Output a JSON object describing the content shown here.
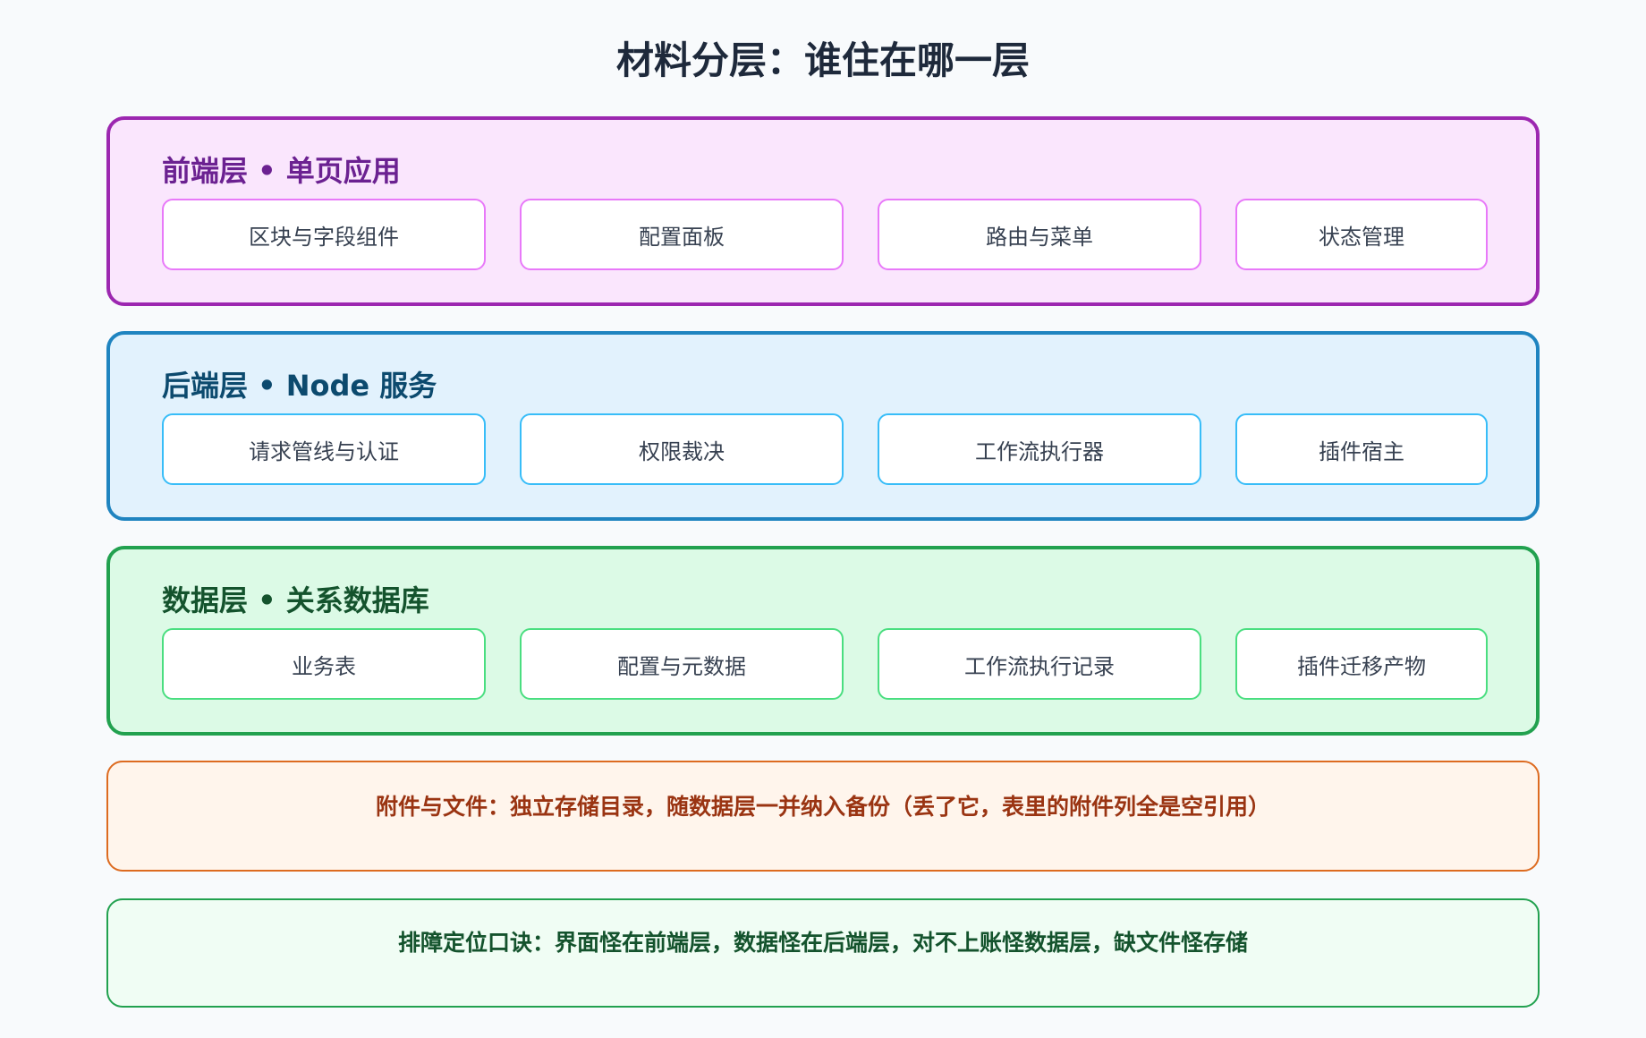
{
  "title": "材料分层：谁住在哪一层",
  "layers": [
    {
      "title": "前端层 • 单页应用",
      "items": [
        "区块与字段组件",
        "配置面板",
        "路由与菜单",
        "状态管理"
      ]
    },
    {
      "title": "后端层 • Node 服务",
      "items": [
        "请求管线与认证",
        "权限裁决",
        "工作流执行器",
        "插件宿主"
      ]
    },
    {
      "title": "数据层 • 关系数据库",
      "items": [
        "业务表",
        "配置与元数据",
        "工作流执行记录",
        "插件迁移产物"
      ]
    }
  ],
  "notes": {
    "attachments": "附件与文件：独立存储目录，随数据层一并纳入备份（丢了它，表里的附件列全是空引用）",
    "mnemonic": "排障定位口诀：界面怪在前端层，数据怪在后端层，对不上账怪数据层，缺文件怪存储"
  },
  "colors": {
    "frontend": "#9c27b0",
    "backend": "#1f84c0",
    "data": "#22a14f",
    "attachments": "#dd6b20"
  }
}
